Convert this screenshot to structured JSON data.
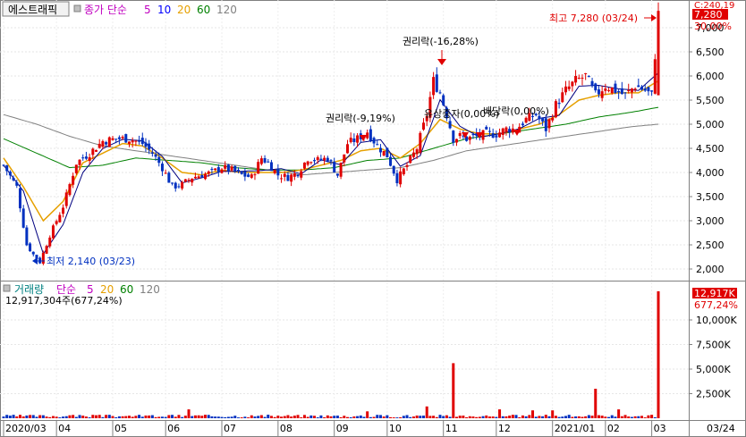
{
  "title": "에스트래픽",
  "price_legend": [
    {
      "text": "종가 단순",
      "color": "#c000c0"
    },
    {
      "text": "5",
      "color": "#c000c0"
    },
    {
      "text": "10",
      "color": "#0000ff"
    },
    {
      "text": "20",
      "color": "#e6a000"
    },
    {
      "text": "60",
      "color": "#008000"
    },
    {
      "text": "120",
      "color": "#808080"
    }
  ],
  "volume_legend": [
    {
      "text": "거래량",
      "color": "#008080"
    },
    {
      "text": "단순",
      "color": "#c000c0"
    },
    {
      "text": "5",
      "color": "#c000c0"
    },
    {
      "text": "20",
      "color": "#e6a000"
    },
    {
      "text": "60",
      "color": "#008000"
    },
    {
      "text": "120",
      "color": "#808080"
    }
  ],
  "volume_info": "12,917,304주(677,24%)",
  "current_price_badge": "7,280",
  "current_change": "30,00%",
  "prev_close_label": "C:240,19",
  "volume_badge": "12,917K",
  "volume_change": "677,24%",
  "x_end_label": "03/24",
  "annotations": {
    "high": "최고 7,280 (03/24)",
    "low": "최저 2,140 (03/23)",
    "rights1": "권리락(-9,19%)",
    "rights2": "권리락(-16,28%)",
    "overlap": "유상증자(0,00%)",
    "dividend": "배당락(0,00%)"
  },
  "colors": {
    "up": "#e00000",
    "down": "#0030c0",
    "ma5": "#c000c0",
    "ma10": "#000080",
    "ma20": "#e6a000",
    "ma60": "#008000",
    "ma120": "#808080"
  },
  "chart_data": {
    "type": "candlestick",
    "price_axis": {
      "min": 2000,
      "max": 7280,
      "ticks": [
        "7,000",
        "6,500",
        "6,000",
        "5,500",
        "5,000",
        "4,500",
        "4,000",
        "3,500",
        "3,000",
        "2,500",
        "2,000"
      ]
    },
    "volume_axis": {
      "min": 0,
      "max": 12917,
      "unit": "K",
      "ticks": [
        "10,000K",
        "7,500K",
        "5,000K",
        "2,500K"
      ]
    },
    "x_ticks": [
      "2020/03",
      "04",
      "05",
      "06",
      "07",
      "08",
      "09",
      "10",
      "11",
      "12",
      "2021/01",
      "02",
      "03"
    ],
    "close_path": [
      [
        0,
        4150
      ],
      [
        4,
        3700
      ],
      [
        7,
        2500
      ],
      [
        9,
        2300
      ],
      [
        11,
        2140
      ],
      [
        14,
        2700
      ],
      [
        18,
        3300
      ],
      [
        22,
        4200
      ],
      [
        26,
        4400
      ],
      [
        30,
        4650
      ],
      [
        34,
        4700
      ],
      [
        38,
        4700
      ],
      [
        42,
        4600
      ],
      [
        45,
        4400
      ],
      [
        48,
        4100
      ],
      [
        51,
        3700
      ],
      [
        54,
        3750
      ],
      [
        57,
        3900
      ],
      [
        60,
        3950
      ],
      [
        63,
        4000
      ],
      [
        66,
        4100
      ],
      [
        69,
        4050
      ],
      [
        72,
        3950
      ],
      [
        75,
        3900
      ],
      [
        78,
        4300
      ],
      [
        80,
        4200
      ],
      [
        83,
        3950
      ],
      [
        86,
        3900
      ],
      [
        89,
        4000
      ],
      [
        92,
        4300
      ],
      [
        95,
        4250
      ],
      [
        98,
        4300
      ],
      [
        101,
        3950
      ],
      [
        104,
        4600
      ],
      [
        107,
        4700
      ],
      [
        110,
        4850
      ],
      [
        113,
        4550
      ],
      [
        116,
        4350
      ],
      [
        119,
        3850
      ],
      [
        122,
        4150
      ],
      [
        125,
        4500
      ],
      [
        128,
        5200
      ],
      [
        130,
        5900
      ],
      [
        132,
        5650
      ],
      [
        134,
        5200
      ],
      [
        136,
        4700
      ],
      [
        138,
        4750
      ],
      [
        140,
        4700
      ],
      [
        143,
        4750
      ],
      [
        146,
        4800
      ],
      [
        149,
        4800
      ],
      [
        152,
        4900
      ],
      [
        155,
        4900
      ],
      [
        158,
        5100
      ],
      [
        161,
        5200
      ],
      [
        164,
        4900
      ],
      [
        167,
        5400
      ],
      [
        170,
        5700
      ],
      [
        173,
        5900
      ],
      [
        176,
        6000
      ],
      [
        179,
        5600
      ],
      [
        182,
        5800
      ],
      [
        185,
        5700
      ],
      [
        188,
        5600
      ],
      [
        191,
        5800
      ],
      [
        194,
        5700
      ],
      [
        196,
        5600
      ],
      [
        198,
        7280
      ]
    ],
    "ma20_path": [
      [
        0,
        4300
      ],
      [
        6,
        3700
      ],
      [
        12,
        3000
      ],
      [
        18,
        3400
      ],
      [
        24,
        4200
      ],
      [
        30,
        4400
      ],
      [
        36,
        4600
      ],
      [
        42,
        4550
      ],
      [
        48,
        4300
      ],
      [
        54,
        4000
      ],
      [
        60,
        3950
      ],
      [
        66,
        4050
      ],
      [
        72,
        4000
      ],
      [
        78,
        4000
      ],
      [
        84,
        4000
      ],
      [
        90,
        4050
      ],
      [
        96,
        4150
      ],
      [
        102,
        4250
      ],
      [
        108,
        4450
      ],
      [
        114,
        4500
      ],
      [
        120,
        4300
      ],
      [
        126,
        4600
      ],
      [
        132,
        5100
      ],
      [
        138,
        4900
      ],
      [
        144,
        4800
      ],
      [
        150,
        4800
      ],
      [
        156,
        4900
      ],
      [
        162,
        5000
      ],
      [
        168,
        5200
      ],
      [
        174,
        5500
      ],
      [
        180,
        5600
      ],
      [
        186,
        5650
      ],
      [
        192,
        5650
      ],
      [
        198,
        5900
      ]
    ],
    "ma60_path": [
      [
        0,
        4700
      ],
      [
        10,
        4400
      ],
      [
        20,
        4100
      ],
      [
        30,
        4150
      ],
      [
        40,
        4300
      ],
      [
        50,
        4250
      ],
      [
        60,
        4200
      ],
      [
        70,
        4100
      ],
      [
        80,
        4050
      ],
      [
        90,
        4050
      ],
      [
        100,
        4100
      ],
      [
        110,
        4250
      ],
      [
        120,
        4300
      ],
      [
        130,
        4500
      ],
      [
        140,
        4700
      ],
      [
        150,
        4800
      ],
      [
        160,
        4900
      ],
      [
        170,
        5000
      ],
      [
        180,
        5150
      ],
      [
        190,
        5250
      ],
      [
        198,
        5350
      ]
    ],
    "ma120_path": [
      [
        0,
        5200
      ],
      [
        10,
        5000
      ],
      [
        20,
        4750
      ],
      [
        30,
        4550
      ],
      [
        40,
        4450
      ],
      [
        50,
        4350
      ],
      [
        60,
        4250
      ],
      [
        70,
        4150
      ],
      [
        80,
        4050
      ],
      [
        90,
        3950
      ],
      [
        100,
        4000
      ],
      [
        110,
        4050
      ],
      [
        120,
        4100
      ],
      [
        130,
        4250
      ],
      [
        140,
        4450
      ],
      [
        150,
        4550
      ],
      [
        160,
        4650
      ],
      [
        170,
        4750
      ],
      [
        180,
        4850
      ],
      [
        190,
        4950
      ],
      [
        198,
        5000
      ]
    ],
    "volume_spikes": [
      {
        "i": 20,
        "v": 300
      },
      {
        "i": 56,
        "v": 900
      },
      {
        "i": 110,
        "v": 700
      },
      {
        "i": 128,
        "v": 1200
      },
      {
        "i": 136,
        "v": 5600
      },
      {
        "i": 150,
        "v": 900
      },
      {
        "i": 160,
        "v": 800
      },
      {
        "i": 166,
        "v": 800
      },
      {
        "i": 179,
        "v": 3000
      },
      {
        "i": 186,
        "v": 900
      },
      {
        "i": 198,
        "v": 12917
      }
    ],
    "n": 199
  }
}
